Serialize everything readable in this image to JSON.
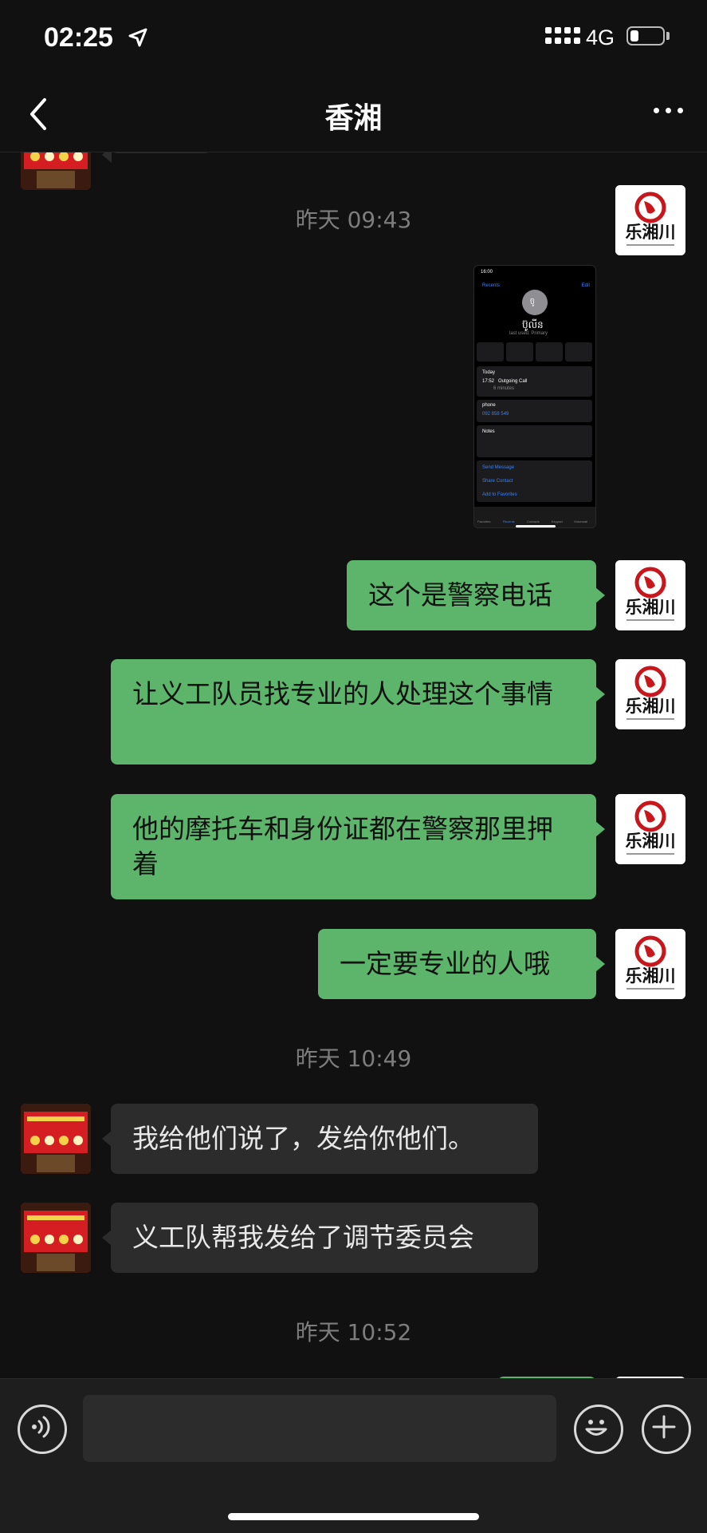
{
  "status_bar": {
    "time": "02:25",
    "network": "4G",
    "battery_level": 0.25
  },
  "header": {
    "title": "香湘"
  },
  "chat": {
    "timestamps": [
      "昨天 09:43",
      "昨天 10:49",
      "昨天 10:52"
    ],
    "messages": [
      {
        "text": "这个是警察电话"
      },
      {
        "text": "让义工队员找专业的人处理这个事情"
      },
      {
        "text": "他的摩托车和身份证都在警察那里押着"
      },
      {
        "text": "一定要专业的人哦"
      },
      {
        "text": "我给他们说了，发给你他们。"
      },
      {
        "text": "义工队帮我发给了调节委员会"
      }
    ],
    "avatar_text": "乐湘川",
    "screenshot": {
      "time": "16:00",
      "back": "Recents",
      "edit": "Edit",
      "avatar_glyph": "ប៊ូ",
      "name": "ប៊ូលីន",
      "last_used": "last used: Primary",
      "actions": [
        "message",
        "call",
        "video",
        "mail"
      ],
      "today": "Today",
      "call_time": "17:52",
      "call_type": "Outgoing Call",
      "call_duration": "6 minutes",
      "phone_label": "phone",
      "phone_number": "092 858 549",
      "notes_label": "Notes",
      "links": [
        "Send Message",
        "Share Contact",
        "Add to Favorites"
      ],
      "tabs": [
        "Favorites",
        "Recents",
        "Contacts",
        "Keypad",
        "Voicemail"
      ]
    }
  },
  "colors": {
    "outgoing_bubble": "#5cb56b",
    "incoming_bubble": "#2c2c2c",
    "background": "#111111"
  }
}
